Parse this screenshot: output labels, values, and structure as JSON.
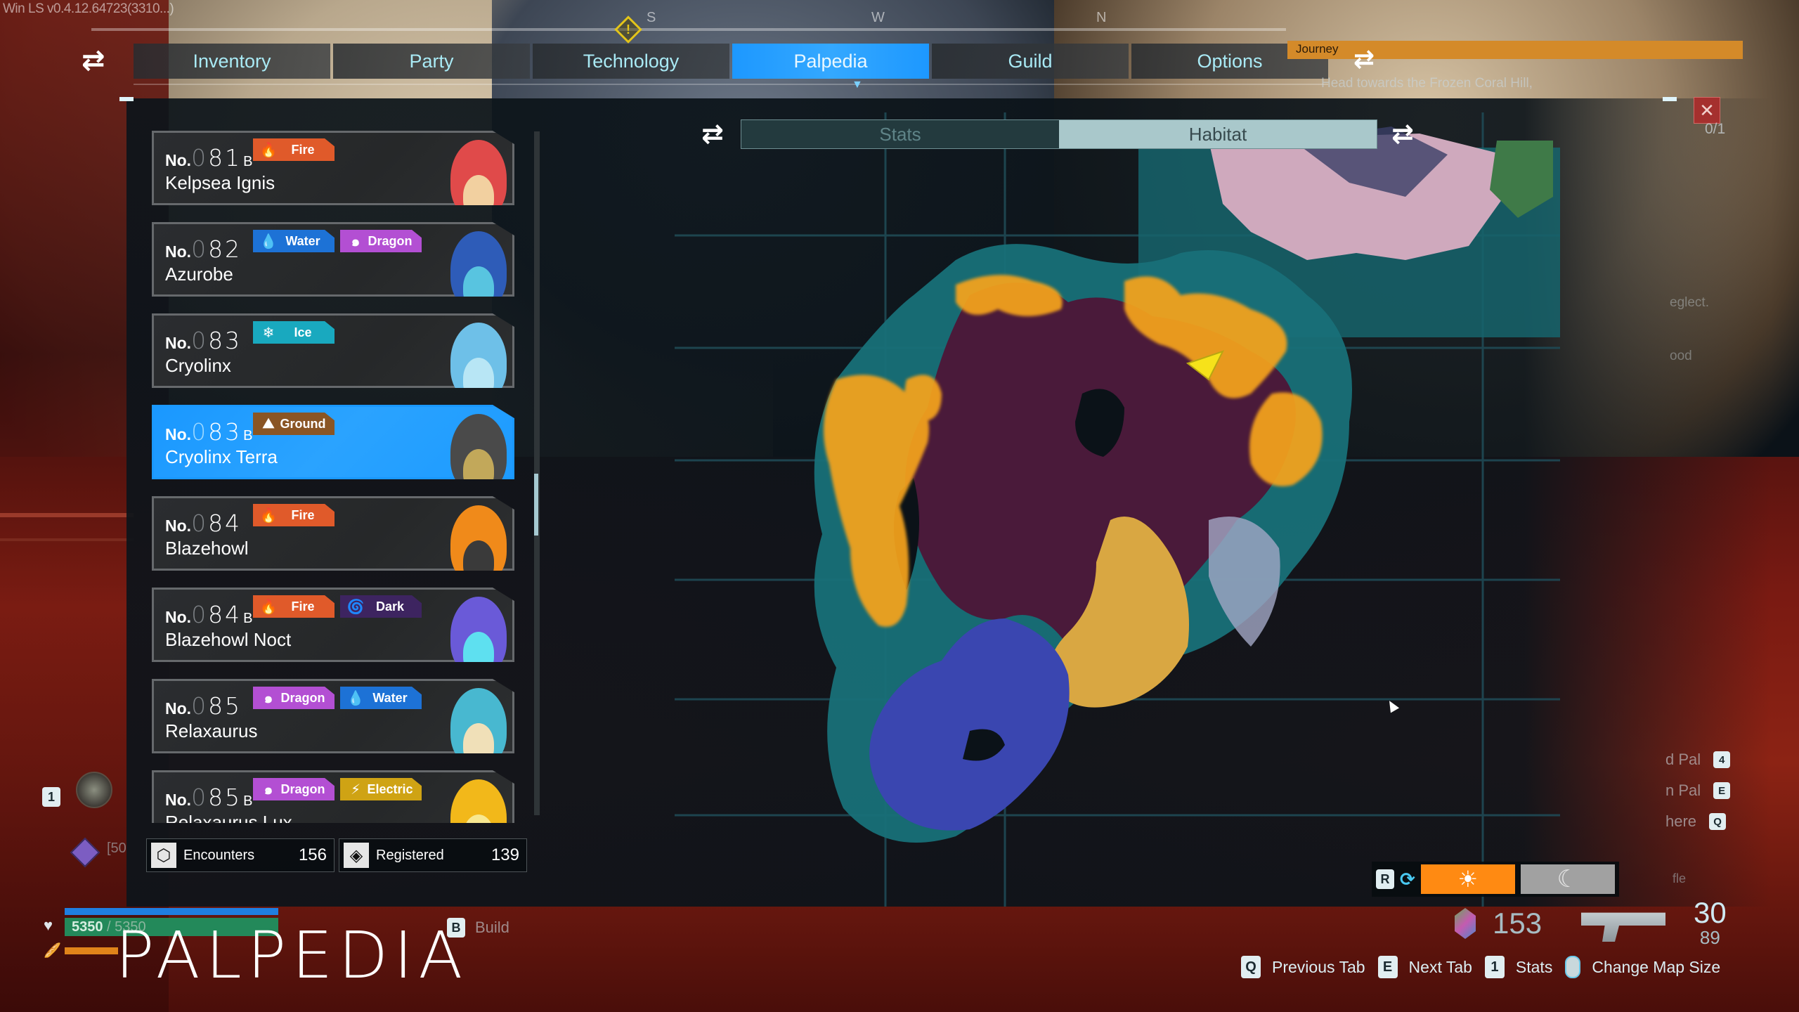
{
  "version_text": "Win LS v0.4.12.64723(3310...)",
  "compass": {
    "letters": [
      "S",
      "W",
      "N"
    ]
  },
  "tabs": [
    {
      "label": "Inventory",
      "active": false
    },
    {
      "label": "Party",
      "active": false
    },
    {
      "label": "Technology",
      "active": false
    },
    {
      "label": "Palpedia",
      "active": true
    },
    {
      "label": "Guild",
      "active": false
    },
    {
      "label": "Options",
      "active": false
    }
  ],
  "journey": {
    "label": "Journey",
    "text": "Head towards the Frozen Coral Hill,",
    "count": "0/1"
  },
  "type_colors": {
    "Fire": "#e05a2a",
    "Water": "#1d72d6",
    "Dragon": "#b34fd3",
    "Ice": "#19a9bf",
    "Ground": "#8a5524",
    "Dark": "#3d2460",
    "Electric": "#cfa314"
  },
  "type_icons": {
    "Fire": "🔥",
    "Water": "💧",
    "Dragon": "๑",
    "Ice": "❄",
    "Ground": "⛰",
    "Dark": "🌀",
    "Electric": "⚡"
  },
  "pals": [
    {
      "no_lead": "0",
      "no_digits": "81",
      "suffix": "B",
      "name": "Kelpsea Ignis",
      "types": [
        "Fire"
      ],
      "selected": false,
      "portrait": [
        "#e04a4a",
        "#f2d0a0"
      ]
    },
    {
      "no_lead": "0",
      "no_digits": "82",
      "suffix": "",
      "name": "Azurobe",
      "types": [
        "Water",
        "Dragon"
      ],
      "selected": false,
      "portrait": [
        "#2e5cb8",
        "#58c4e0"
      ]
    },
    {
      "no_lead": "0",
      "no_digits": "83",
      "suffix": "",
      "name": "Cryolinx",
      "types": [
        "Ice"
      ],
      "selected": false,
      "portrait": [
        "#6ec0e8",
        "#b8e6f5"
      ]
    },
    {
      "no_lead": "0",
      "no_digits": "83",
      "suffix": "B",
      "name": "Cryolinx Terra",
      "types": [
        "Ground"
      ],
      "selected": true,
      "portrait": [
        "#4a4a4a",
        "#c2a85a"
      ]
    },
    {
      "no_lead": "0",
      "no_digits": "84",
      "suffix": "",
      "name": "Blazehowl",
      "types": [
        "Fire"
      ],
      "selected": false,
      "portrait": [
        "#f08a1a",
        "#3a3a3a"
      ]
    },
    {
      "no_lead": "0",
      "no_digits": "84",
      "suffix": "B",
      "name": "Blazehowl Noct",
      "types": [
        "Fire",
        "Dark"
      ],
      "selected": false,
      "portrait": [
        "#6a5ad8",
        "#5ee0f0"
      ]
    },
    {
      "no_lead": "0",
      "no_digits": "85",
      "suffix": "",
      "name": "Relaxaurus",
      "types": [
        "Dragon",
        "Water"
      ],
      "selected": false,
      "portrait": [
        "#48b8d0",
        "#f0e0b8"
      ]
    },
    {
      "no_lead": "0",
      "no_digits": "85",
      "suffix": "B",
      "name": "Relaxaurus Lux",
      "types": [
        "Dragon",
        "Electric"
      ],
      "selected": false,
      "portrait": [
        "#f2b81a",
        "#f8e890"
      ]
    }
  ],
  "list_scroll": {
    "position_fraction": 0.55,
    "visible_fraction": 0.09
  },
  "counters": {
    "encounters": {
      "label": "Encounters",
      "value": "156",
      "icon": "hexagon-eye"
    },
    "registered": {
      "label": "Registered",
      "value": "139",
      "icon": "palsphere"
    }
  },
  "map_toggle": {
    "stats": "Stats",
    "habitat": "Habitat",
    "active": "Habitat"
  },
  "daynight": {
    "key": "R",
    "day_icon": "☀",
    "night_icon": "☾",
    "active": "day"
  },
  "hud": {
    "party_key": "1",
    "pal_level": "[50",
    "hp_current": "5350",
    "hp_max": "5350",
    "hp_fraction": 1.0,
    "hunger_fraction": 0.25,
    "page_title": "PALPEDIA",
    "build_key": "B",
    "build_label": "Build",
    "sphere_count": "153",
    "ammo_loaded": "30",
    "ammo_total": "89",
    "weapon_label": "fle"
  },
  "right_hints": [
    {
      "label": "d Pal",
      "key": "4"
    },
    {
      "label": "n Pal",
      "key": "E"
    },
    {
      "label": "here",
      "key": "Q"
    }
  ],
  "right_side_text": [
    "eglect.",
    "ood"
  ],
  "bottom_hints": [
    {
      "key": "Q",
      "label": "Previous Tab"
    },
    {
      "key": "E",
      "label": "Next Tab"
    },
    {
      "key": "1",
      "label": "Stats"
    },
    {
      "key": "mouse",
      "label": "Change Map Size"
    }
  ],
  "colors": {
    "active_tab": "#1d98ff",
    "selected_card": "#1a98ff",
    "tab_text": "#a9eaf5",
    "journey": "#d48a29",
    "day": "#ff8a12",
    "night": "#a1a1a1",
    "habitat_orange": "#f5a31a"
  }
}
